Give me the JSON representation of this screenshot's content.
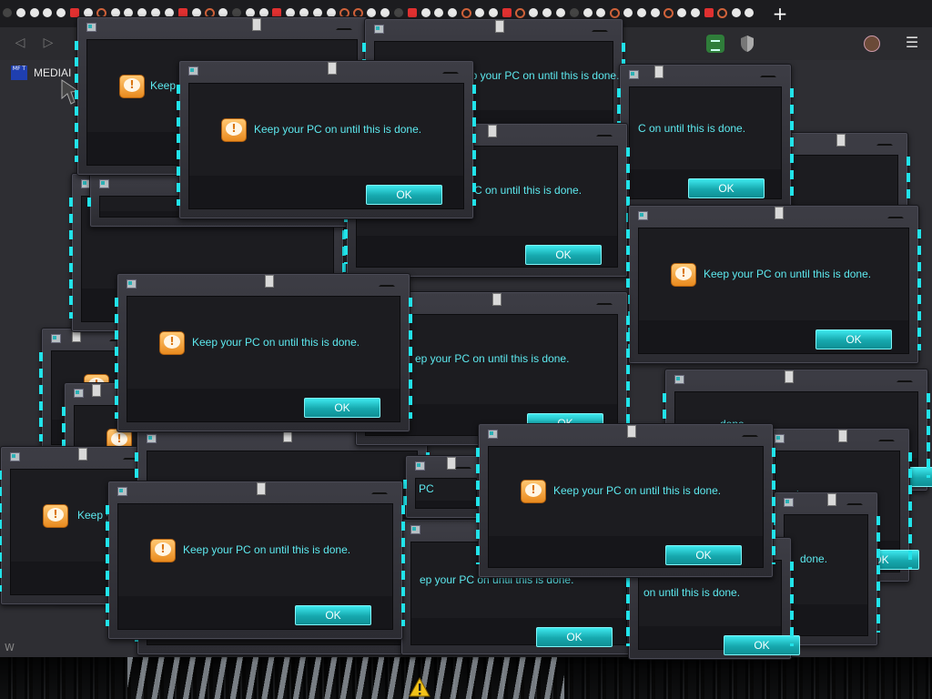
{
  "browser": {
    "new_tab_symbol": "+",
    "back_symbol": "◁",
    "forward_symbol": "▷",
    "menu_symbol": "☰",
    "bookmark": {
      "icon_text": "MF T",
      "label": "MEDIAI"
    },
    "extensions": [
      "chat-extension-icon",
      "shield-extension-icon"
    ]
  },
  "dialog": {
    "message": "Keep your PC on until this is done.",
    "ok_label": "OK"
  },
  "partial_messages": {
    "tail_c": "C on until this is done.",
    "tail_ep": "ep your PC on until this is done.",
    "tail_on": "on until this is done.",
    "tail_done": "done.",
    "head_keep": "Keep",
    "head_keepy": "Keep y",
    "frag_pc": "PC"
  },
  "misc": {
    "bottom_left_glyph": "W"
  },
  "colors": {
    "message_text": "#5de9ef",
    "accent_cyan": "#21e3ea",
    "button_top": "#3de9ee",
    "button_bottom": "#0f8f94",
    "dialog_frame": "#3d3d45",
    "dialog_body": "#16161a",
    "warning_orange": "#e98a1e"
  }
}
